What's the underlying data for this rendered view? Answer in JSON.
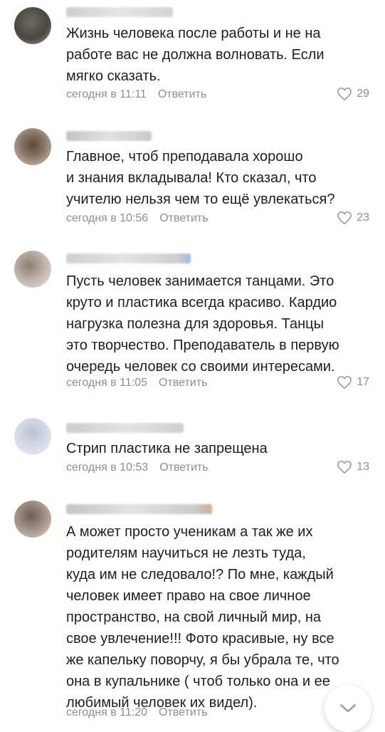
{
  "comments": [
    {
      "text": "Жизнь человека после работы и не на\nработе вас не должна волновать. Если\nмягко сказать.",
      "time": "сегодня в 11:11",
      "reply": "Ответить",
      "likes": "29"
    },
    {
      "text": "Главное, чтоб преподавала хорошо\nи знания вкладывала! Кто сказал, что\nучителю нельзя чем то ещё увлекаться?",
      "time": "сегодня в 10:56",
      "reply": "Ответить",
      "likes": "23"
    },
    {
      "text": "Пусть человек занимается танцами. Это\nкруто и пластика всегда красиво. Кардио\nнагрузка полезна для здоровья. Танцы\nэто творчество. Преподаватель в первую\nочередь человек со своими интересами.",
      "time": "сегодня в 11:05",
      "reply": "Ответить",
      "likes": "17"
    },
    {
      "text": "Стрип пластика не запрещена",
      "time": "сегодня в 10:53",
      "reply": "Ответить",
      "likes": "13"
    },
    {
      "text": "А может просто ученикам  а так же их\nродителям научиться не лезть туда,\nкуда им не следовало!? По мне, каждый\nчеловек имеет право на свое личное\nпространство, на свой личный мир, на\nсвое увлечение!!! Фото красивые, ну все\nже капельку поворчу, я бы убрала те, что\nона в купальнике ( чтоб только она и ее\nлюбимый человек их видел).",
      "time": "сегодня в 11:20",
      "reply": "Ответить",
      "likes": ""
    }
  ],
  "icons": {
    "like": "heart-outline-icon",
    "scroll": "chevron-down-icon"
  },
  "colors": {
    "meta": "#8e8e8e",
    "text": "#1e1e1e"
  }
}
